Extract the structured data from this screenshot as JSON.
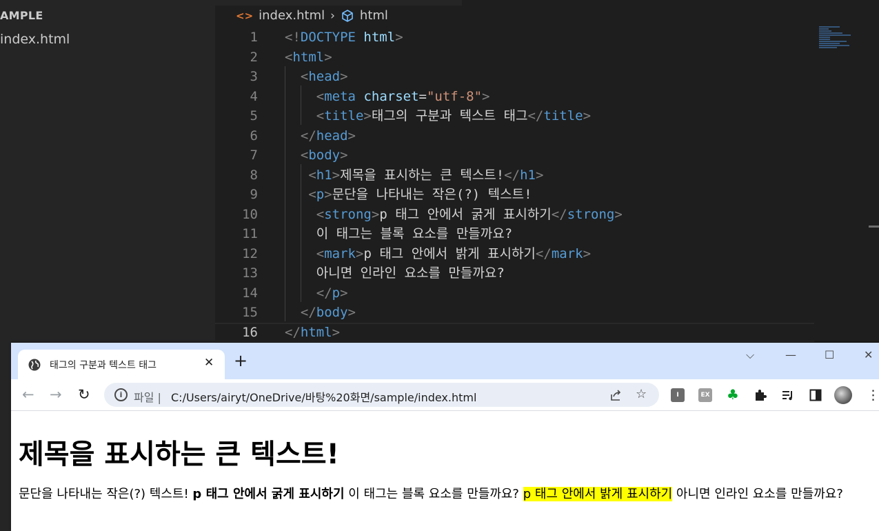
{
  "explorer": {
    "folder": "AMPLE",
    "file": "index.html"
  },
  "editor": {
    "breadcrumb": {
      "file": "index.html",
      "symbol": "html",
      "html_icon": "<>"
    },
    "lines": [
      {
        "n": "1",
        "tokens": [
          [
            "punc",
            "<!"
          ],
          [
            "tag",
            "DOCTYPE"
          ],
          [
            "text",
            " "
          ],
          [
            "attr",
            "html"
          ],
          [
            "punc",
            ">"
          ]
        ]
      },
      {
        "n": "2",
        "tokens": [
          [
            "punc",
            "<"
          ],
          [
            "tag",
            "html"
          ],
          [
            "punc",
            ">"
          ]
        ]
      },
      {
        "n": "3",
        "tokens": [
          [
            "text",
            "  "
          ],
          [
            "punc",
            "<"
          ],
          [
            "tag",
            "head"
          ],
          [
            "punc",
            ">"
          ]
        ]
      },
      {
        "n": "4",
        "tokens": [
          [
            "text",
            "    "
          ],
          [
            "punc",
            "<"
          ],
          [
            "tag",
            "meta"
          ],
          [
            "text",
            " "
          ],
          [
            "attr",
            "charset"
          ],
          [
            "text",
            "="
          ],
          [
            "str",
            "\"utf-8\""
          ],
          [
            "punc",
            ">"
          ]
        ]
      },
      {
        "n": "5",
        "tokens": [
          [
            "text",
            "    "
          ],
          [
            "punc",
            "<"
          ],
          [
            "tag",
            "title"
          ],
          [
            "punc",
            ">"
          ],
          [
            "text",
            "태그의 구분과 텍스트 태그"
          ],
          [
            "punc",
            "</"
          ],
          [
            "tag",
            "title"
          ],
          [
            "punc",
            ">"
          ]
        ]
      },
      {
        "n": "6",
        "tokens": [
          [
            "text",
            "  "
          ],
          [
            "punc",
            "</"
          ],
          [
            "tag",
            "head"
          ],
          [
            "punc",
            ">"
          ]
        ]
      },
      {
        "n": "7",
        "tokens": [
          [
            "text",
            "  "
          ],
          [
            "punc",
            "<"
          ],
          [
            "tag",
            "body"
          ],
          [
            "punc",
            ">"
          ]
        ]
      },
      {
        "n": "8",
        "tokens": [
          [
            "text",
            "   "
          ],
          [
            "punc",
            "<"
          ],
          [
            "tag",
            "h1"
          ],
          [
            "punc",
            ">"
          ],
          [
            "text",
            "제목을 표시하는 큰 텍스트!"
          ],
          [
            "punc",
            "</"
          ],
          [
            "tag",
            "h1"
          ],
          [
            "punc",
            ">"
          ]
        ]
      },
      {
        "n": "9",
        "tokens": [
          [
            "text",
            "   "
          ],
          [
            "punc",
            "<"
          ],
          [
            "tag",
            "p"
          ],
          [
            "punc",
            ">"
          ],
          [
            "text",
            "문단을 나타내는 작은(?) 텍스트!"
          ]
        ]
      },
      {
        "n": "10",
        "tokens": [
          [
            "text",
            "    "
          ],
          [
            "punc",
            "<"
          ],
          [
            "tag",
            "strong"
          ],
          [
            "punc",
            ">"
          ],
          [
            "text",
            "p 태그 안에서 굵게 표시하기"
          ],
          [
            "punc",
            "</"
          ],
          [
            "tag",
            "strong"
          ],
          [
            "punc",
            ">"
          ]
        ]
      },
      {
        "n": "11",
        "tokens": [
          [
            "text",
            "    이 태그는 블록 요소를 만들까요?"
          ]
        ]
      },
      {
        "n": "12",
        "tokens": [
          [
            "text",
            "    "
          ],
          [
            "punc",
            "<"
          ],
          [
            "tag",
            "mark"
          ],
          [
            "punc",
            ">"
          ],
          [
            "text",
            "p 태그 안에서 밝게 표시하기"
          ],
          [
            "punc",
            "</"
          ],
          [
            "tag",
            "mark"
          ],
          [
            "punc",
            ">"
          ]
        ]
      },
      {
        "n": "13",
        "tokens": [
          [
            "text",
            "    아니면 인라인 요소를 만들까요?"
          ]
        ]
      },
      {
        "n": "14",
        "tokens": [
          [
            "text",
            "    "
          ],
          [
            "punc",
            "</"
          ],
          [
            "tag",
            "p"
          ],
          [
            "punc",
            ">"
          ]
        ]
      },
      {
        "n": "15",
        "tokens": [
          [
            "text",
            "  "
          ],
          [
            "punc",
            "</"
          ],
          [
            "tag",
            "body"
          ],
          [
            "punc",
            ">"
          ]
        ]
      },
      {
        "n": "16",
        "tokens": [
          [
            "punc",
            "</"
          ],
          [
            "tag",
            "html"
          ],
          [
            "punc",
            ">"
          ]
        ]
      }
    ]
  },
  "browser": {
    "tab_title": "태그의 구분과 텍스트 태그",
    "tab_close": "✕",
    "new_tab": "+",
    "window_controls": {
      "dropdown": "⌵",
      "minimize": "—",
      "maximize": "☐",
      "close": "✕"
    },
    "nav": {
      "back": "←",
      "forward": "→",
      "reload": "↻"
    },
    "url_prefix": "파일 |",
    "url": "C:/Users/airyt/OneDrive/바탕%20화면/sample/index.html",
    "extensions": {
      "i_label": "I",
      "ex_label": "EX"
    },
    "menu": "⋮"
  },
  "page": {
    "h1": "제목을 표시하는 큰 텍스트!",
    "p_text1": "문단을 나타내는 작은(?) 텍스트! ",
    "strong": "p 태그 안에서 굵게 표시하기",
    "p_text2": " 이 태그는 블록 요소를 만들까요? ",
    "mark": "p 태그 안에서 밝게 표시하기",
    "p_text3": " 아니면 인라인 요소를 만들까요?"
  },
  "colors": {
    "editor_bg": "#1e1e1e",
    "sidebar_bg": "#252526",
    "tag": "#569cd6",
    "attr": "#9cdcfe",
    "string": "#ce9178",
    "punct": "#808080",
    "chrome_tabbar": "#d3e3fd",
    "mark": "#ffff00"
  }
}
